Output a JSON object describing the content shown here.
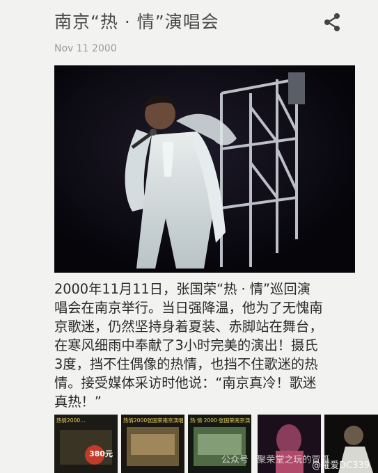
{
  "article": {
    "title": "南京“热 · 情”演唱会",
    "date": "Nov 11 2000",
    "body": "2000年11月11日，张国荣“热 · 情”巡回演\n唱会在南京举行。当日强降温，他为了无愧南\n京歌迷，仍然坚持身着夏装、赤脚站在舞台，\n在寒风细雨中奉献了3小时完美的演出！摄氏\n3度，挡不住偶像的热情，也挡不住歌迷的热\n情。接受媒体采访时他说：“南京真冷！歌迷\n真热！”"
  },
  "share_icon": "share-icon",
  "thumbnails": [
    {
      "caption": "热情2000…",
      "price": "380元"
    },
    {
      "caption": "热情2000张国荣南京演唱"
    },
    {
      "caption": "热·情·2000·张国荣南京演"
    },
    {
      "caption": ""
    },
    {
      "caption": ""
    }
  ],
  "watermark": {
    "account": "公众号 · 聚荣堂之玩的冒哥",
    "handle": "@耀爱DC339"
  },
  "colors": {
    "background": "#f2f2f0",
    "text": "#2a2a2a",
    "date": "#9a9a9a"
  }
}
